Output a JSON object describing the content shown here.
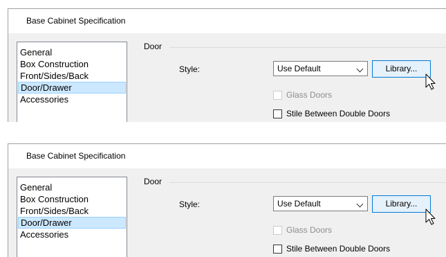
{
  "panels": [
    {
      "title": "Base Cabinet Specification",
      "categories": [
        "General",
        "Box Construction",
        "Front/Sides/Back",
        "Door/Drawer",
        "Accessories"
      ],
      "selected_category": "Door/Drawer",
      "group": "Door",
      "style_label": "Style:",
      "style_value": "Use Default",
      "library_button": "Library...",
      "glass_doors": {
        "label": "Glass Doors",
        "enabled": false,
        "checked": false
      },
      "stile": {
        "label": "Stile Between Double Doors",
        "enabled": true,
        "checked": false
      }
    },
    {
      "title": "Base Cabinet Specification",
      "categories": [
        "General",
        "Box Construction",
        "Front/Sides/Back",
        "Door/Drawer",
        "Accessories"
      ],
      "selected_category": "Door/Drawer",
      "group": "Door",
      "style_label": "Style:",
      "style_value": "Use Default",
      "library_button": "Library...",
      "glass_doors": {
        "label": "Glass Doors",
        "enabled": false,
        "checked": false
      },
      "stile": {
        "label": "Stile Between Double Doors",
        "enabled": true,
        "checked": false
      }
    }
  ],
  "colors": {
    "selection": "#cce8ff",
    "button_border": "#0078d7",
    "dialog_bg": "#f0f0f0"
  },
  "icons": {
    "cursor": "mouse-pointer-icon",
    "dropdown": "chevron-down-icon"
  }
}
